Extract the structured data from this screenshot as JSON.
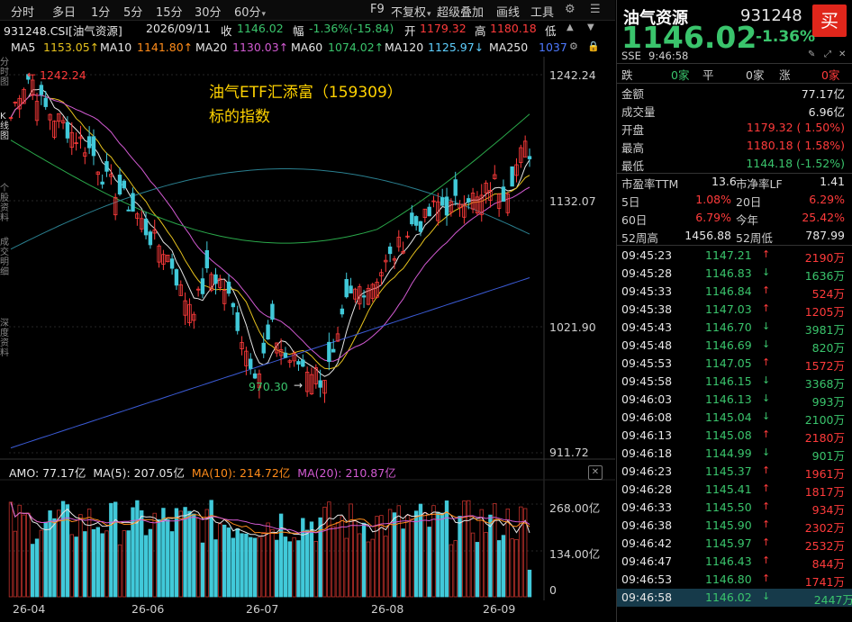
{
  "toolbar": {
    "tabs": [
      "分时",
      "多日",
      "1分",
      "5分",
      "15分",
      "30分",
      "60分"
    ],
    "right_items": [
      "F9",
      "不复权",
      "超级叠加",
      "画线",
      "工具"
    ],
    "icons": [
      "settings-icon",
      "menu-icon"
    ]
  },
  "info": {
    "code": "931248.CSI[油气资源]",
    "date": "2026/09/11",
    "close_label": "收",
    "close": "1146.02",
    "change_label": "幅",
    "change": "-1.36%(-15.84)",
    "open_label": "开",
    "open": "1179.32",
    "high_label": "高",
    "high": "1180.18",
    "low_label": "低"
  },
  "ma": {
    "ma5": "MA5",
    "ma5_val": "1153.05↑",
    "ma10": "MA10",
    "ma10_val": "1141.80↑",
    "ma20": "MA20",
    "ma20_val": "1130.03↑",
    "ma60": "MA60",
    "ma60_val": "1074.02↑",
    "ma120": "MA120",
    "ma120_val": "1125.97↓",
    "ma250": "MA250",
    "ma250_val": "1037"
  },
  "price_axis": {
    "top": "1242.24",
    "mid": "1132.07",
    "low": "1021.90",
    "bottom": "911.72"
  },
  "annotations": {
    "high_mark": "1242.24",
    "low_mark": "970.30",
    "title_line1": "油气ETF汇添富（159309）",
    "title_line2": "标的指数"
  },
  "amo": {
    "label": "AMO: 77.17亿",
    "ma5": "MA(5): 207.05亿",
    "ma10": "MA(10): 214.72亿",
    "ma20": "MA(20): 210.87亿",
    "axis_top": "268.00亿",
    "axis_mid": "134.00亿",
    "axis_zero": "0"
  },
  "xaxis": [
    "26-04",
    "26-06",
    "26-07",
    "26-08",
    "26-09"
  ],
  "left_strip": [
    "分时图",
    "K线图",
    "个股资料",
    "成交明细",
    "深度资料"
  ],
  "quote": {
    "name": "油气资源",
    "code": "931248",
    "price": "1146.02",
    "pct": "-1.36%",
    "buy": "买",
    "exchange": "SSE",
    "time": "9:46:58",
    "stats_row": {
      "fall_label": "跌",
      "fall": "0家",
      "flat_label": "平",
      "flat": "0家",
      "rise_label": "涨",
      "rise": "0家"
    },
    "fields": [
      {
        "label": "金额",
        "value": "77.17亿"
      },
      {
        "label": "成交量",
        "value": "6.96亿"
      },
      {
        "label": "开盘",
        "value": "1179.32 ( 1.50%)"
      },
      {
        "label": "最高",
        "value": "1180.18 ( 1.58%)"
      },
      {
        "label": "最低",
        "value": "1144.18 (-1.52%)"
      }
    ],
    "pe_label": "市盈率TTM",
    "pe": "13.6",
    "pb_label": "市净率LF",
    "pb": "1.41",
    "d5_label": "5日",
    "d5": "1.08%",
    "d20_label": "20日",
    "d20": "6.29%",
    "d60_label": "60日",
    "d60": "6.79%",
    "ytd_label": "今年",
    "ytd": "25.42%",
    "w52h_label": "52周高",
    "w52h": "1456.88",
    "w52l_label": "52周低",
    "w52l": "787.99"
  },
  "trades": [
    {
      "time": "09:45:23",
      "price": "1147.21",
      "dir": "up",
      "amount": "2190万"
    },
    {
      "time": "09:45:28",
      "price": "1146.83",
      "dir": "down",
      "amount": "1636万"
    },
    {
      "time": "09:45:33",
      "price": "1146.84",
      "dir": "up",
      "amount": "524万"
    },
    {
      "time": "09:45:38",
      "price": "1147.03",
      "dir": "up",
      "amount": "1205万"
    },
    {
      "time": "09:45:43",
      "price": "1146.70",
      "dir": "down",
      "amount": "3981万"
    },
    {
      "time": "09:45:48",
      "price": "1146.69",
      "dir": "down",
      "amount": "820万"
    },
    {
      "time": "09:45:53",
      "price": "1147.05",
      "dir": "up",
      "amount": "1572万"
    },
    {
      "time": "09:45:58",
      "price": "1146.15",
      "dir": "down",
      "amount": "3368万"
    },
    {
      "time": "09:46:03",
      "price": "1146.13",
      "dir": "down",
      "amount": "993万"
    },
    {
      "time": "09:46:08",
      "price": "1145.04",
      "dir": "down",
      "amount": "2100万"
    },
    {
      "time": "09:46:13",
      "price": "1145.08",
      "dir": "up",
      "amount": "2180万"
    },
    {
      "time": "09:46:18",
      "price": "1144.99",
      "dir": "down",
      "amount": "901万"
    },
    {
      "time": "09:46:23",
      "price": "1145.37",
      "dir": "up",
      "amount": "1961万"
    },
    {
      "time": "09:46:28",
      "price": "1145.41",
      "dir": "up",
      "amount": "1817万"
    },
    {
      "time": "09:46:33",
      "price": "1145.50",
      "dir": "up",
      "amount": "934万"
    },
    {
      "time": "09:46:38",
      "price": "1145.90",
      "dir": "up",
      "amount": "2302万"
    },
    {
      "time": "09:46:42",
      "price": "1145.97",
      "dir": "up",
      "amount": "2532万"
    },
    {
      "time": "09:46:47",
      "price": "1146.43",
      "dir": "up",
      "amount": "844万"
    },
    {
      "time": "09:46:53",
      "price": "1146.80",
      "dir": "up",
      "amount": "1741万"
    },
    {
      "time": "09:46:58",
      "price": "1146.02",
      "dir": "down",
      "amount": "2447万"
    }
  ],
  "colors": {
    "up": "#ff3b3b",
    "down": "#3ac46c",
    "candle_down": "#41c9d9",
    "candle_up": "#ff3b3b",
    "grid": "#2a2a2a"
  }
}
